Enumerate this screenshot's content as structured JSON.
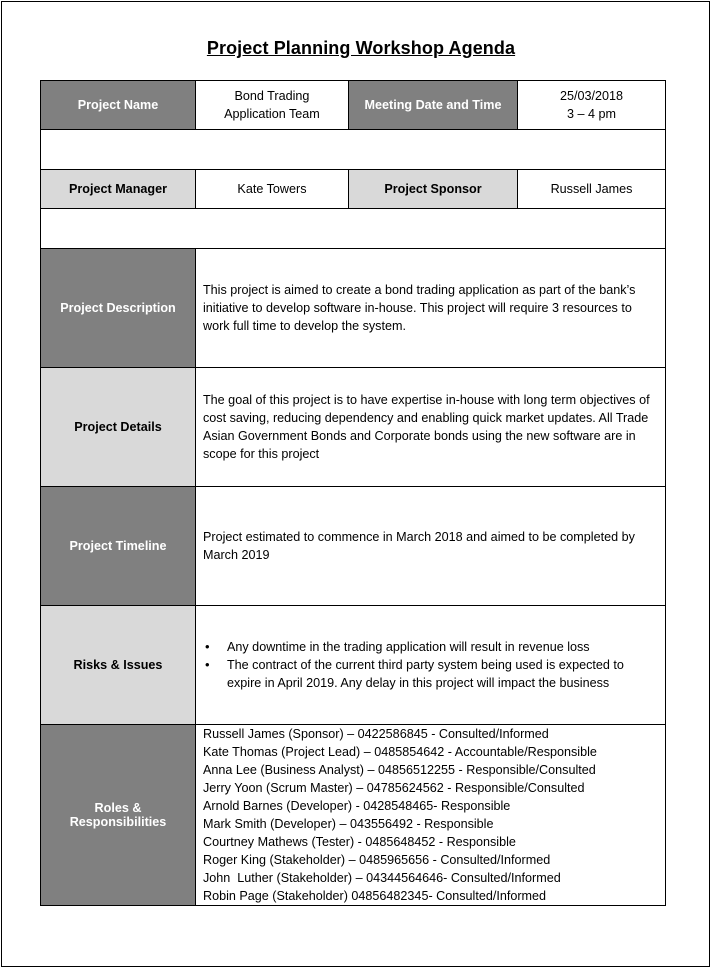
{
  "document": {
    "title": "Project Planning Workshop Agenda"
  },
  "header_row": {
    "project_name_label": "Project Name",
    "project_name_line1": "Bond Trading",
    "project_name_line2": "Application Team",
    "meeting_label": "Meeting Date and Time",
    "meeting_date": "25/03/2018",
    "meeting_time": "3 – 4 pm"
  },
  "people_row": {
    "manager_label": "Project Manager",
    "manager_value": "Kate Towers",
    "sponsor_label": "Project Sponsor",
    "sponsor_value": "Russell James"
  },
  "sections": {
    "description": {
      "label": "Project Description",
      "text": "This project is aimed to create a bond trading application as part of the bank’s initiative to develop software in-house. This project will require 3 resources to work full time to develop the system."
    },
    "details": {
      "label": "Project Details",
      "text": "The goal of this project is to have expertise in-house with long term objectives of cost saving, reducing dependency and enabling quick market updates. All Trade Asian Government Bonds and Corporate bonds using the new software are in scope for this project"
    },
    "timeline": {
      "label": "Project Timeline",
      "text": "Project estimated to commence in March 2018 and aimed to be completed by March 2019"
    },
    "risks": {
      "label": "Risks & Issues",
      "items": [
        "Any downtime in the trading application will result in revenue loss",
        "The contract of the current third party system being used is expected to expire in April 2019. Any delay in this project will impact the business"
      ]
    },
    "roles": {
      "label_line1": "Roles &",
      "label_line2": "Responsibilities",
      "items": [
        "Russell James (Sponsor) – 0422586845 - Consulted/Informed",
        "Kate Thomas (Project Lead) – 0485854642 - Accountable/Responsible",
        "Anna Lee (Business Analyst) – 04856512255 - Responsible/Consulted",
        "Jerry Yoon (Scrum Master) – 04785624562 - Responsible/Consulted",
        "Arnold Barnes (Developer) - 0428548465- Responsible",
        "Mark Smith (Developer) – 043556492 - Responsible",
        "Courtney Mathews (Tester) - 0485648452 - Responsible",
        "Roger King (Stakeholder) – 0485965656 - Consulted/Informed",
        "John  Luther (Stakeholder) – 04344564646- Consulted/Informed",
        "Robin Page (Stakeholder) 04856482345- Consulted/Informed"
      ]
    }
  }
}
